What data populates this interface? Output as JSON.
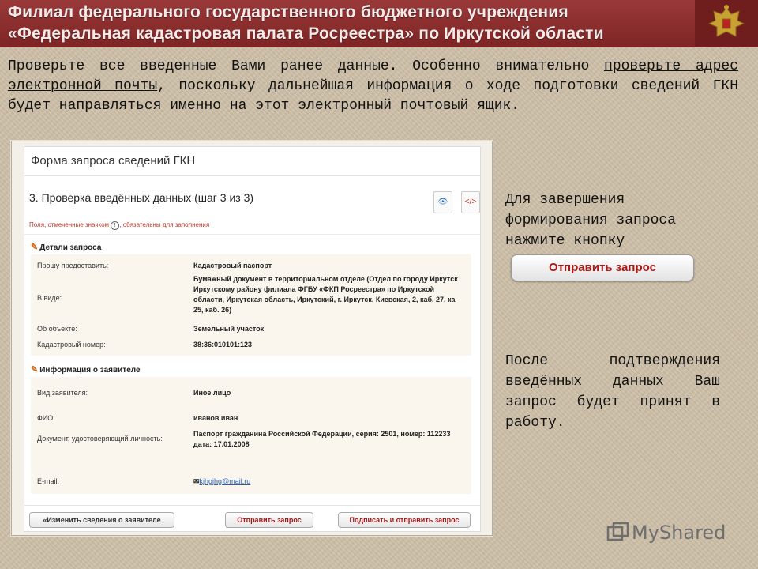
{
  "header": {
    "line1": "Филиал федерального государственного бюджетного учреждения",
    "line2": "«Федеральная кадастровая палата Росреестра» по Иркутской области"
  },
  "intro": {
    "part1": "Проверьте все введенные Вами ранее данные. Особенно внимательно ",
    "underlined": "проверьте адрес электронной почты",
    "part2": ", поскольку дальнейшая информация о ходе подготовки сведений ГКН будет направляться именно на этот электронный почтовый ящик."
  },
  "form": {
    "title": "Форма запроса сведений ГКН",
    "step_title": "3. Проверка введённых данных (шаг 3 из 3)",
    "required_note_a": "Поля, отмеченные значком",
    "required_mark": "!",
    "required_note_b": ", обязательны для заполнения",
    "section1": {
      "title": "Детали запроса",
      "rows": [
        {
          "label": "Прошу предоставить:",
          "value": "Кадастровый паспорт"
        },
        {
          "label": "В виде:",
          "value": "Бумажный документ в территориальном отделе (Отдел по городу Иркутск Иркутскому району филиала ФГБУ «ФКП Росреестра» по Иркутской области, Иркутская область, Иркутский, г. Иркутск, Киевская, 2, каб. 27, ка 25, каб. 26)"
        },
        {
          "label": "Об объекте:",
          "value": "Земельный участок"
        },
        {
          "label": "Кадастровый номер:",
          "value": "38:36:010101:123"
        }
      ]
    },
    "section2": {
      "title": "Информация о заявителе",
      "rows": [
        {
          "label": "Вид заявителя:",
          "value": "Иное лицо"
        },
        {
          "label": "ФИО:",
          "value": "иванов иван"
        },
        {
          "label": "Документ, удостоверяющий личность:",
          "value": "Паспорт гражданина Российской Федерации, серия: 2501, номер: 112233 дата: 17.01.2008"
        },
        {
          "label": "E-mail:",
          "value": "kjhgjhg@mail.ru"
        }
      ]
    },
    "buttons": {
      "change": "«Изменить сведения о заявителе",
      "send": "Отправить запрос",
      "sign_send": "Подписать и отправить запрос"
    }
  },
  "side": {
    "text1": "Для завершения формирования запроса нажмите кнопку",
    "big_button": "Отправить запрос",
    "text2": "После подтверждения введённых данных Ваш запрос будет принят в работу."
  },
  "watermark": "MyShared",
  "colors": {
    "header_bg": "#8e2f2f",
    "accent_red": "#b01818",
    "background": "#cdbfa8"
  }
}
